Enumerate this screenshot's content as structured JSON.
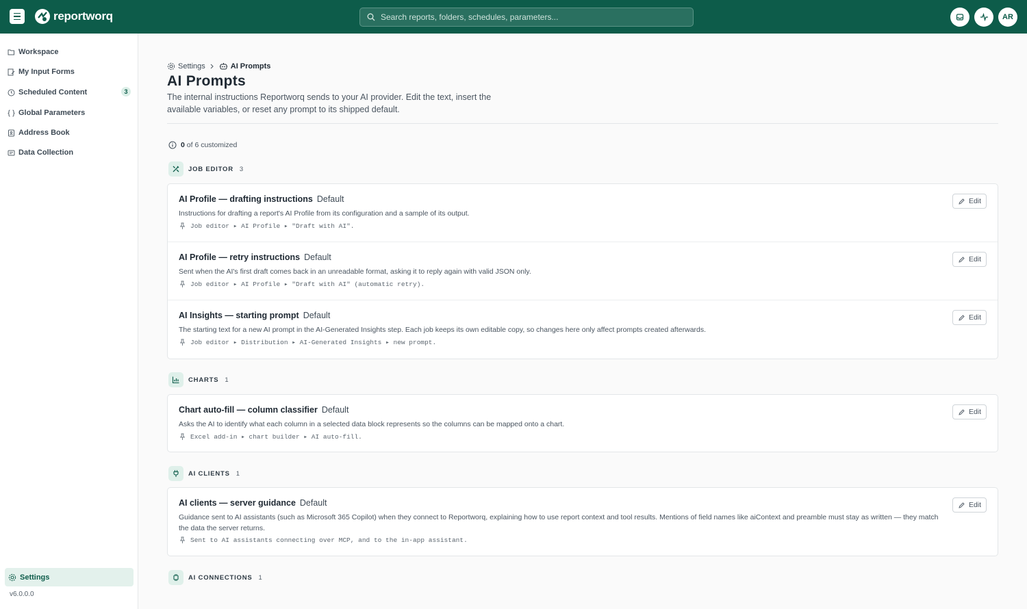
{
  "app": {
    "name": "reportworq"
  },
  "search": {
    "placeholder": "Search reports, folders, schedules, parameters..."
  },
  "topbar": {
    "avatar_initials": "AR"
  },
  "sidebar": {
    "items": [
      {
        "label": "Workspace",
        "icon": "folder-open-icon"
      },
      {
        "label": "My Input Forms",
        "icon": "form-edit-icon"
      },
      {
        "label": "Scheduled Content",
        "icon": "clock-icon",
        "badge": "3"
      },
      {
        "label": "Global Parameters",
        "icon": "braces-icon"
      },
      {
        "label": "Address Book",
        "icon": "contact-book-icon"
      },
      {
        "label": "Data Collection",
        "icon": "data-form-icon"
      }
    ],
    "settings_label": "Settings",
    "version": "v6.0.0.0"
  },
  "breadcrumb": {
    "parent": "Settings",
    "current": "AI Prompts"
  },
  "page": {
    "title": "AI Prompts",
    "description": "The internal instructions Reportworq sends to your AI provider. Edit the text, insert the available variables, or reset any prompt to its shipped default."
  },
  "summary": {
    "customized": "0",
    "rest": "of 6 customized"
  },
  "edit_label": "Edit",
  "sections": [
    {
      "title": "JOB EDITOR",
      "count": "3",
      "icon": "tools-icon",
      "prompts": [
        {
          "title": "AI Profile — drafting instructions",
          "status": "Default",
          "description": "Instructions for drafting a report's AI Profile from its configuration and a sample of its output.",
          "location": "Job editor ▸ AI Profile ▸ \"Draft with AI\"."
        },
        {
          "title": "AI Profile — retry instructions",
          "status": "Default",
          "description": "Sent when the AI's first draft comes back in an unreadable format, asking it to reply again with valid JSON only.",
          "location": "Job editor ▸ AI Profile ▸ \"Draft with AI\" (automatic retry)."
        },
        {
          "title": "AI Insights — starting prompt",
          "status": "Default",
          "description": "The starting text for a new AI prompt in the AI-Generated Insights step. Each job keeps its own editable copy, so changes here only affect prompts created afterwards.",
          "location": "Job editor ▸ Distribution ▸ AI-Generated Insights ▸ new prompt."
        }
      ]
    },
    {
      "title": "CHARTS",
      "count": "1",
      "icon": "bar-chart-icon",
      "prompts": [
        {
          "title": "Chart auto-fill — column classifier",
          "status": "Default",
          "description": "Asks the AI to identify what each column in a selected data block represents so the columns can be mapped onto a chart.",
          "location": "Excel add-in ▸ chart builder ▸ AI auto-fill."
        }
      ]
    },
    {
      "title": "AI CLIENTS",
      "count": "1",
      "icon": "plug-icon",
      "prompts": [
        {
          "title": "AI clients — server guidance",
          "status": "Default",
          "description": "Guidance sent to AI assistants (such as Microsoft 365 Copilot) when they connect to Reportworq, explaining how to use report context and tool results. Mentions of field names like aiContext and preamble must stay as written — they match the data the server returns.",
          "location": "Sent to AI assistants connecting over MCP, and to the in-app assistant."
        }
      ]
    },
    {
      "title": "AI CONNECTIONS",
      "count": "1",
      "icon": "chip-icon",
      "prompts": []
    }
  ],
  "colors": {
    "brand": "#0d5c4a",
    "accent_bg": "#dff0ea"
  }
}
